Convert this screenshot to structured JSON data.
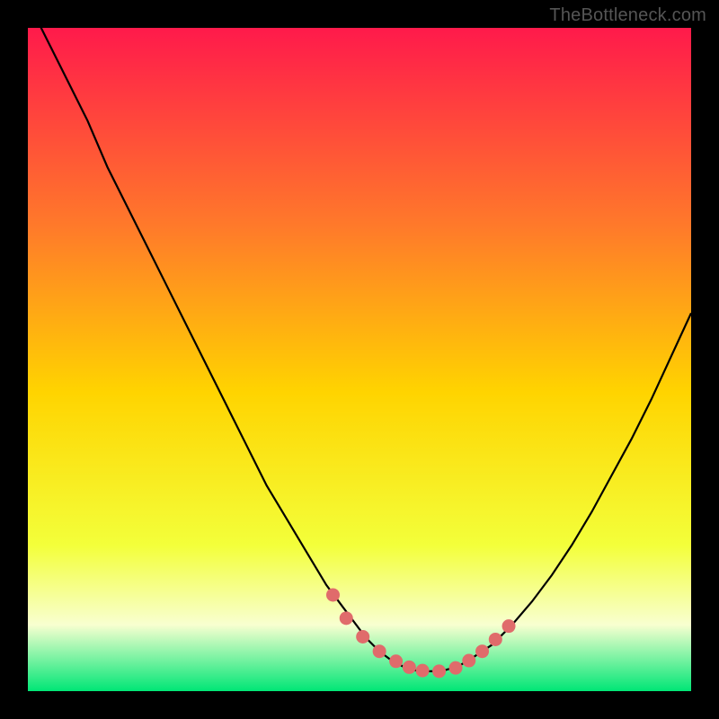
{
  "watermark": "TheBottleneck.com",
  "colors": {
    "gradient_top": "#ff1a4b",
    "gradient_mid_upper": "#ff7a2a",
    "gradient_mid": "#ffd400",
    "gradient_mid_lower": "#f3ff3a",
    "gradient_pale": "#f8ffd0",
    "gradient_green": "#00e676",
    "curve": "#000000",
    "dot_fill": "#e06b6b",
    "dot_stroke": "#c94f4f"
  },
  "chart_data": {
    "type": "line",
    "title": "",
    "xlabel": "",
    "ylabel": "",
    "xlim": [
      0,
      100
    ],
    "ylim": [
      0,
      100
    ],
    "grid": false,
    "legend": false,
    "series": [
      {
        "name": "bottleneck-curve",
        "x": [
          0,
          3,
          6,
          9,
          12,
          15,
          18,
          21,
          24,
          27,
          30,
          33,
          36,
          39,
          42,
          45,
          48,
          51,
          53,
          55,
          57,
          59,
          61,
          63,
          65,
          67,
          70,
          73,
          76,
          79,
          82,
          85,
          88,
          91,
          94,
          97,
          100
        ],
        "y": [
          104,
          98,
          92,
          86,
          79,
          73,
          67,
          61,
          55,
          49,
          43,
          37,
          31,
          26,
          21,
          16,
          12,
          8,
          6,
          4.5,
          3.5,
          3,
          3,
          3.2,
          3.8,
          5,
          7,
          10,
          13.5,
          17.5,
          22,
          27,
          32.5,
          38,
          44,
          50.5,
          57
        ]
      }
    ],
    "dots": {
      "name": "sample-points",
      "x": [
        46,
        48,
        50.5,
        53,
        55.5,
        57.5,
        59.5,
        62,
        64.5,
        66.5,
        68.5,
        70.5,
        72.5
      ],
      "y": [
        14.5,
        11,
        8.2,
        6,
        4.5,
        3.6,
        3.1,
        3.0,
        3.5,
        4.6,
        6.0,
        7.8,
        9.8
      ]
    }
  }
}
